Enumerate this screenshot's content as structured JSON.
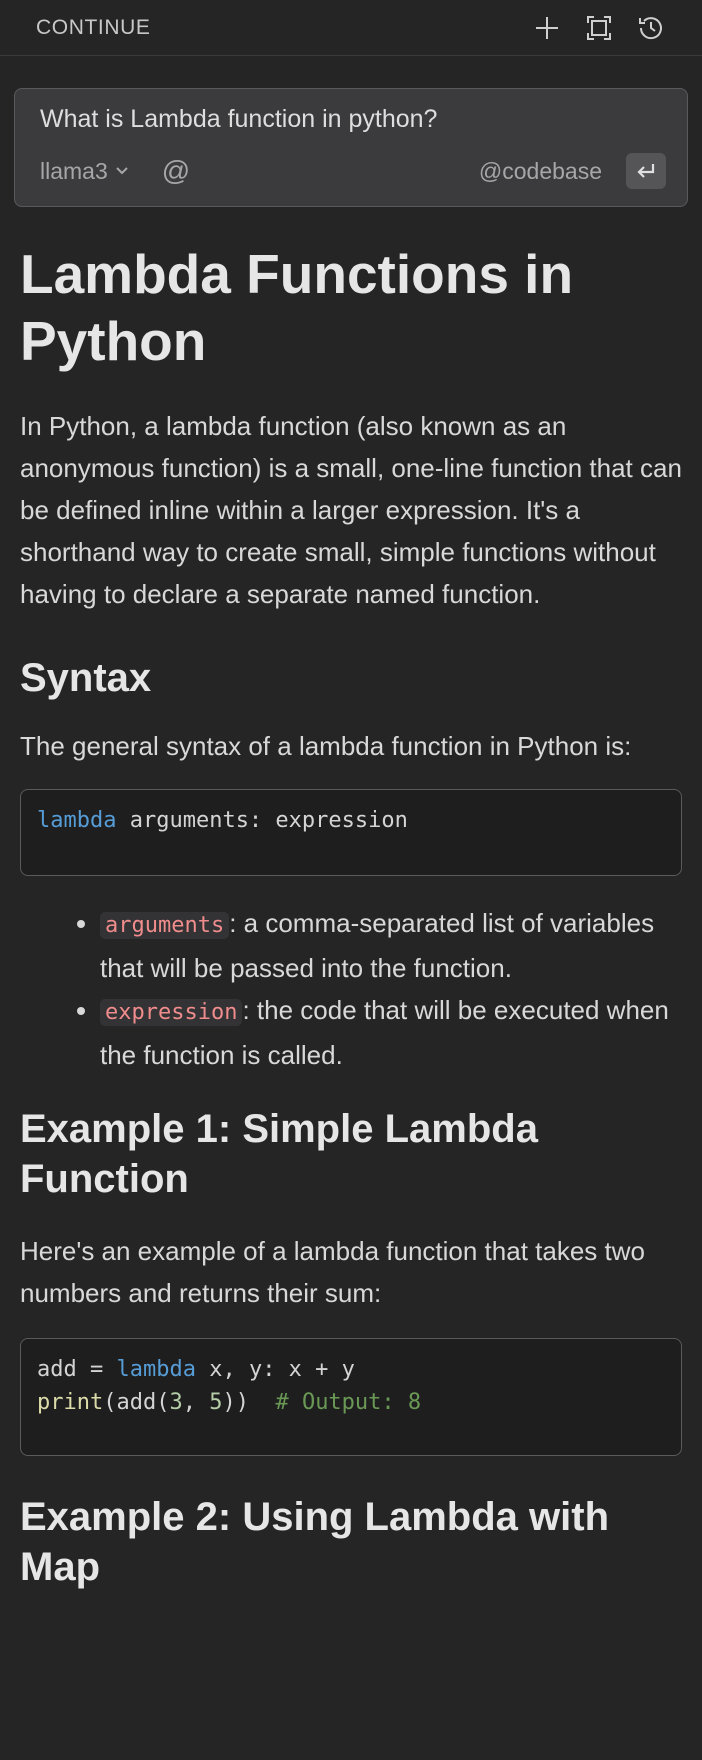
{
  "header": {
    "title": "CONTINUE",
    "icons": [
      "plus-icon",
      "fullscreen-icon",
      "history-icon"
    ]
  },
  "input": {
    "value": "What is Lambda function in python?",
    "model": "llama3",
    "at_symbol": "@",
    "codebase": "@codebase"
  },
  "article": {
    "title": "Lambda Functions in Python",
    "intro": "In Python, a lambda function (also known as an anonymous function) is a small, one-line function that can be defined inline within a larger expression. It's a shorthand way to create small, simple functions without having to declare a separate named function.",
    "syntax_heading": "Syntax",
    "syntax_text": "The general syntax of a lambda function in Python is:",
    "syntax_code": {
      "keyword": "lambda",
      "rest": " arguments: expression"
    },
    "bullets": [
      {
        "code": "arguments",
        "text": ": a comma-separated list of variables that will be passed into the function."
      },
      {
        "code": "expression",
        "text": ": the code that will be executed when the function is called."
      }
    ],
    "example1_heading": "Example 1: Simple Lambda Function",
    "example1_text": "Here's an example of a lambda function that takes two numbers and returns their sum:",
    "example1_code": {
      "line1_a": "add = ",
      "line1_kw": "lambda",
      "line1_b": " x, y: x + y",
      "line2_fn": "print",
      "line2_a": "(add(",
      "line2_n1": "3",
      "line2_b": ", ",
      "line2_n2": "5",
      "line2_c": "))  ",
      "line2_comment": "# Output: 8"
    },
    "example2_heading": "Example 2: Using Lambda with Map"
  }
}
